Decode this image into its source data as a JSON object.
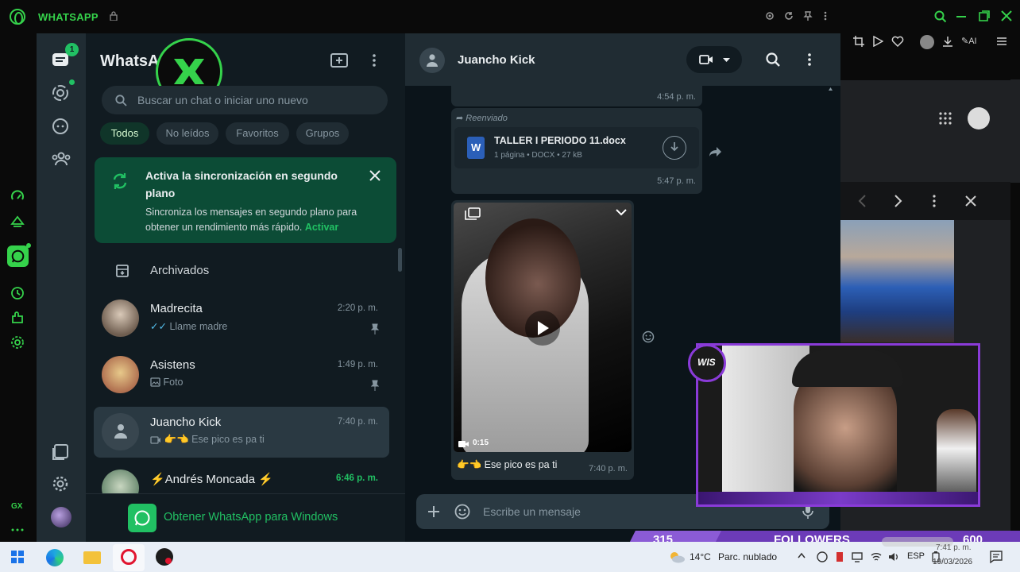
{
  "browser": {
    "app_title": "WHATSAPP",
    "gx_label": "GX"
  },
  "rail": {
    "badge": "1"
  },
  "list": {
    "title": "WhatsA",
    "search_placeholder": "Buscar un chat o iniciar uno nuevo",
    "chips": [
      "Todos",
      "No leídos",
      "Favoritos",
      "Grupos"
    ],
    "sync": {
      "title": "Activa la sincronización en segundo plano",
      "desc": "Sincroniza los mensajes en segundo plano para obtener un rendimiento más rápido.",
      "action": "Activar"
    },
    "archived": "Archivados",
    "chats": [
      {
        "name": "Madrecita",
        "preview": "Llame madre",
        "time": "2:20 p. m."
      },
      {
        "name": "Asistens",
        "preview": "Foto",
        "time": "1:49 p. m."
      },
      {
        "name": "Juancho Kick",
        "preview": "Ese pico es pa ti",
        "time": "7:40 p. m."
      },
      {
        "name": "⚡Andrés Moncada ⚡",
        "preview": "",
        "time": "6:46 p. m."
      }
    ],
    "get_windows": "Obtener WhatsApp para Windows"
  },
  "conversation": {
    "contact": "Juancho Kick",
    "msg1_time": "4:54 p. m.",
    "forwarded": "Reenviado",
    "doc_name": "TALLER I PERIODO 11.docx",
    "doc_meta": "1 página • DOCX • 27 kB",
    "doc_time": "5:47 p. m.",
    "video_duration": "0:15",
    "video_caption": "Ese pico es pa ti",
    "video_time": "7:40 p. m.",
    "composer_placeholder": "Escribe un mensaje"
  },
  "stream": {
    "followers_count": "315",
    "followers_label": "FOLLOWERS",
    "followers_goal": "600",
    "overlay_badge": "WIS"
  },
  "taskbar": {
    "weather_temp": "14°C",
    "weather_desc": "Parc. nublado",
    "lang": "ESP",
    "time": "7:41 p. m.",
    "date": "19/03/2026"
  },
  "colors": {
    "accent": "#21c063",
    "opera_green": "#35d24b",
    "overlay_purple": "#8a3bd8"
  }
}
